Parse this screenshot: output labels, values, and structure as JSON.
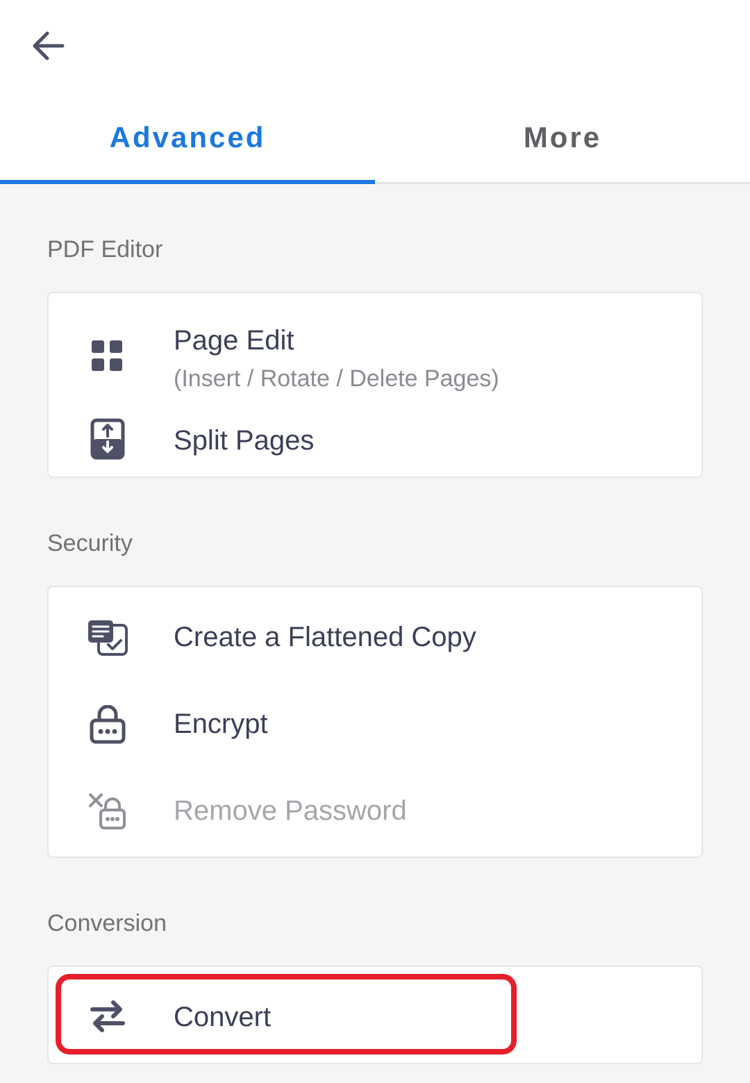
{
  "header": {
    "back_icon": "arrow-left-icon",
    "tabs": [
      {
        "label": "Advanced",
        "active": true
      },
      {
        "label": "More",
        "active": false
      }
    ]
  },
  "sections": {
    "pdf_editor": {
      "title": "PDF Editor",
      "items": [
        {
          "label": "Page Edit",
          "sublabel": "(Insert / Rotate / Delete Pages)",
          "icon": "grid-icon"
        },
        {
          "label": "Split Pages",
          "icon": "split-pages-icon"
        }
      ]
    },
    "security": {
      "title": "Security",
      "items": [
        {
          "label": "Create a Flattened Copy",
          "icon": "flatten-copy-icon"
        },
        {
          "label": "Encrypt",
          "icon": "lock-icon"
        },
        {
          "label": "Remove Password",
          "icon": "remove-password-icon",
          "disabled": true
        }
      ]
    },
    "conversion": {
      "title": "Conversion",
      "items": [
        {
          "label": "Convert",
          "icon": "swap-arrows-icon",
          "highlighted": true
        }
      ]
    }
  },
  "colors": {
    "accent": "#1a78e0",
    "text_primary": "#3b3f58",
    "text_secondary": "#8b8c93",
    "text_disabled": "#a5a6ab",
    "highlight": "#e5202b",
    "background": "#f5f5f5"
  }
}
